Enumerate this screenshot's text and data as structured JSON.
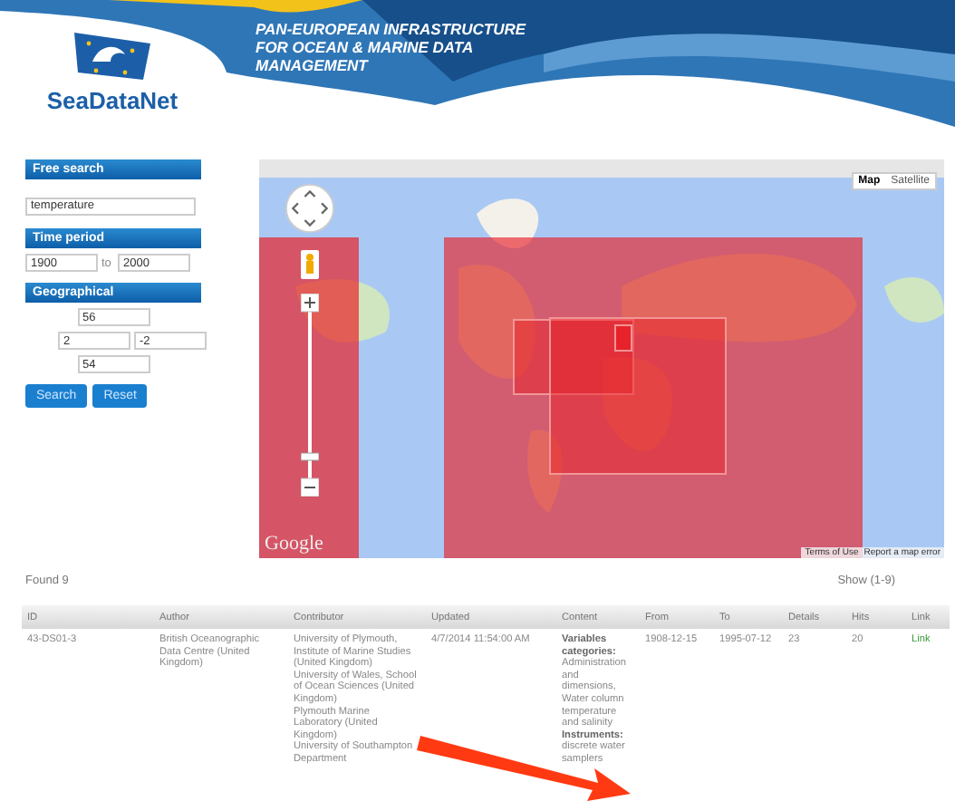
{
  "header": {
    "tagline": "PAN-EUROPEAN INFRASTRUCTURE FOR OCEAN & MARINE DATA MANAGEMENT",
    "logo_text": "SeaDataNet"
  },
  "filters": [
    {
      "title": "Free search",
      "kind": "text",
      "fields": [
        "temperature"
      ]
    },
    {
      "title": "Time period",
      "kind": "range",
      "fields": [
        "1900",
        "2000"
      ],
      "separator": "to"
    },
    {
      "title": "Geographical",
      "kind": "bbox",
      "fields": [
        "56",
        "2",
        "-2",
        "54"
      ]
    }
  ],
  "buttons": [
    "Search",
    "Reset"
  ],
  "map": {
    "map_types": [
      {
        "label": "Map",
        "selected": true
      },
      {
        "label": "Satellite",
        "selected": false
      }
    ],
    "brand": "Google",
    "footer_links": [
      "Terms of Use",
      "Report a map error"
    ]
  },
  "results": {
    "count": "Found 9",
    "pager": "Show (1-9)",
    "columns": [
      "ID",
      "Author",
      "Contributor",
      "Updated",
      "Content",
      "From",
      "To",
      "Details",
      "Hits",
      "Link"
    ],
    "rows": [
      {
        "cells": [
          "43-DS01-3",
          "British Oceanographic Data Centre (United Kingdom)",
          "University of Plymouth, Institute of Marine Studies (United Kingdom)\nUniversity of Wales, School of Ocean Sciences (United Kingdom)\nPlymouth Marine Laboratory (United Kingdom)\nUniversity of Southampton Department",
          "4/7/2014 11:54:00 AM",
          "**Variables categories:** Administration and dimensions, Water column temperature and salinity **Instruments:** discrete water samplers",
          "1908-12-15",
          "1995-07-12",
          "23",
          "20",
          "Link"
        ]
      }
    ]
  }
}
